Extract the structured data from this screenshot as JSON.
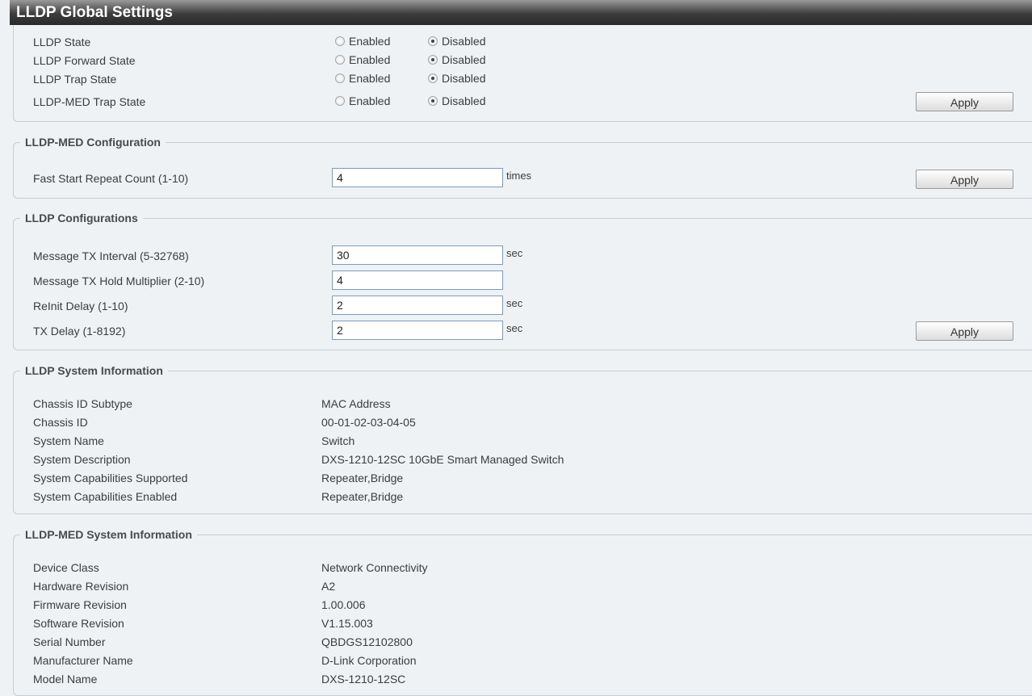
{
  "title": "LLDP Global Settings",
  "global": {
    "rows": [
      {
        "label": "LLDP State",
        "enabled": "Enabled",
        "disabled": "Disabled",
        "selected": "Disabled"
      },
      {
        "label": "LLDP Forward State",
        "enabled": "Enabled",
        "disabled": "Disabled",
        "selected": "Disabled"
      },
      {
        "label": "LLDP Trap State",
        "enabled": "Enabled",
        "disabled": "Disabled",
        "selected": "Disabled"
      },
      {
        "label": "LLDP-MED Trap State",
        "enabled": "Enabled",
        "disabled": "Disabled",
        "selected": "Disabled"
      }
    ],
    "apply": "Apply"
  },
  "med_config": {
    "legend": "LLDP-MED Configuration",
    "fast_start_label": "Fast Start Repeat Count (1-10)",
    "fast_start_value": "4",
    "fast_start_unit": "times",
    "apply": "Apply"
  },
  "lldp_config": {
    "legend": "LLDP Configurations",
    "rows": [
      {
        "label": "Message TX Interval (5-32768)",
        "value": "30",
        "unit": "sec"
      },
      {
        "label": "Message TX Hold Multiplier (2-10)",
        "value": "4",
        "unit": ""
      },
      {
        "label": "ReInit Delay (1-10)",
        "value": "2",
        "unit": "sec"
      },
      {
        "label": "TX Delay (1-8192)",
        "value": "2",
        "unit": "sec"
      }
    ],
    "apply": "Apply"
  },
  "sys_info": {
    "legend": "LLDP System Information",
    "rows": [
      {
        "label": "Chassis ID Subtype",
        "value": "MAC Address"
      },
      {
        "label": "Chassis ID",
        "value": "00-01-02-03-04-05"
      },
      {
        "label": "System Name",
        "value": "Switch"
      },
      {
        "label": "System Description",
        "value": "DXS-1210-12SC 10GbE Smart Managed Switch"
      },
      {
        "label": "System Capabilities Supported",
        "value": "Repeater,Bridge"
      },
      {
        "label": "System Capabilities Enabled",
        "value": "Repeater,Bridge"
      }
    ]
  },
  "med_info": {
    "legend": "LLDP-MED System Information",
    "rows": [
      {
        "label": "Device Class",
        "value": "Network Connectivity"
      },
      {
        "label": "Hardware Revision",
        "value": "A2"
      },
      {
        "label": "Firmware Revision",
        "value": "1.00.006"
      },
      {
        "label": "Software Revision",
        "value": "V1.15.003"
      },
      {
        "label": "Serial Number",
        "value": "QBDGS12102800"
      },
      {
        "label": "Manufacturer Name",
        "value": "D-Link Corporation"
      },
      {
        "label": "Model Name",
        "value": "DXS-1210-12SC"
      }
    ]
  }
}
